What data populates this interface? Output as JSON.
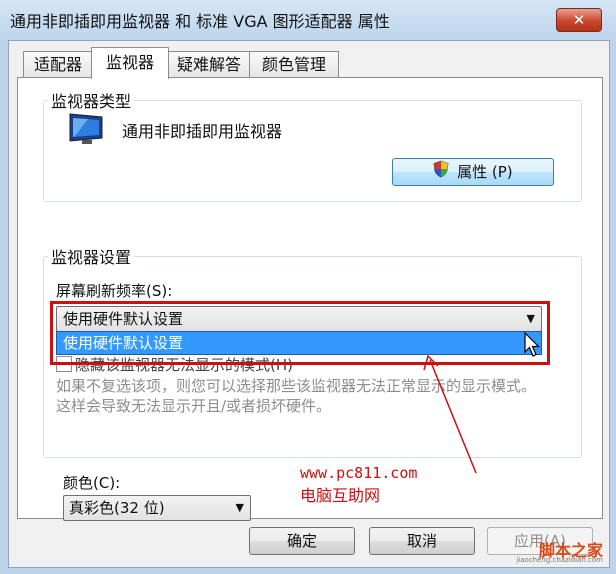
{
  "window": {
    "title": "通用非即插即用监视器 和 标准 VGA 图形适配器 属性",
    "close_label": "✕"
  },
  "tabs": [
    {
      "label": "适配器"
    },
    {
      "label": "监视器"
    },
    {
      "label": "疑难解答"
    },
    {
      "label": "颜色管理"
    }
  ],
  "monitor_type": {
    "group_label": "监视器类型",
    "monitor_name": "通用非即插即用监视器",
    "properties_button": "属性 (P)"
  },
  "monitor_settings": {
    "group_label": "监视器设置",
    "refresh_label": "屏幕刷新频率(S):",
    "refresh_selected": "使用硬件默认设置",
    "dropdown_option": "使用硬件默认设置",
    "hide_modes_label": "隐藏该监视器无法显示的模式(H)",
    "hide_modes_checked": false,
    "description": "如果不复选该项，则您可以选择那些该监视器无法正常显示的显示模式。这样会导致无法显示开且/或者损坏硬件。"
  },
  "colors": {
    "label": "颜色(C):",
    "selected": "真彩色(32 位)"
  },
  "watermarks": {
    "site_url": "www.pc811.com",
    "site_name": "电脑互助网",
    "corner_logo": "脚本之家",
    "corner_url": "jiaocheng.chazidian.com"
  },
  "footer": {
    "ok": "确定",
    "cancel": "取消",
    "apply": "应用(A)"
  },
  "colors_theme": {
    "highlight": "#3399ff",
    "annotation_red": "#cc1010"
  }
}
